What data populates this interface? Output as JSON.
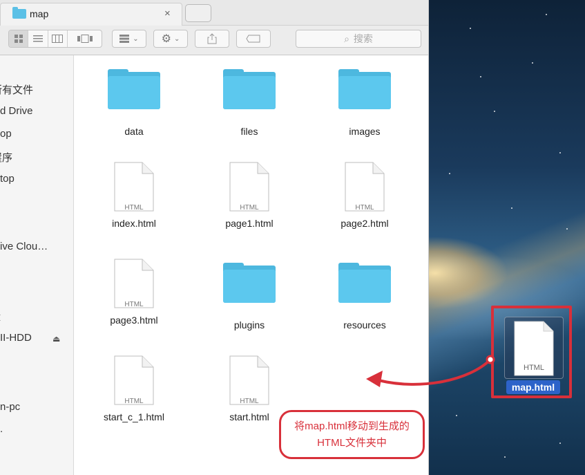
{
  "window": {
    "tab_title": "map",
    "tab_close": "×",
    "search_placeholder": "搜索"
  },
  "sidebar": {
    "items": [
      {
        "label": "所有文件",
        "partial": "斤有文件"
      },
      {
        "label": "d Drive"
      },
      {
        "label": "op"
      },
      {
        "label": "崖序"
      },
      {
        "label": "top"
      },
      {
        "label": "ive Clou…"
      },
      {
        "label": "盘",
        "partial": "ㄛ盘"
      },
      {
        "label": "II-HDD"
      },
      {
        "label": "n-pc"
      },
      {
        "label": "."
      }
    ],
    "eject_icon": "⏏"
  },
  "files": [
    {
      "name": "data",
      "kind": "folder"
    },
    {
      "name": "files",
      "kind": "folder"
    },
    {
      "name": "images",
      "kind": "folder"
    },
    {
      "name": "index.html",
      "kind": "html"
    },
    {
      "name": "page1.html",
      "kind": "html"
    },
    {
      "name": "page2.html",
      "kind": "html"
    },
    {
      "name": "page3.html",
      "kind": "html"
    },
    {
      "name": "plugins",
      "kind": "folder"
    },
    {
      "name": "resources",
      "kind": "folder"
    },
    {
      "name": "start_c_1.html",
      "kind": "html"
    },
    {
      "name": "start.html",
      "kind": "html"
    }
  ],
  "doc_badge": "HTML",
  "desktop_file": {
    "name": "map.html",
    "badge": "HTML"
  },
  "annotation": {
    "text": "将map.html移动到生成的HTML文件夹中",
    "color": "#d8303a"
  },
  "colors": {
    "folder": "#5cc8ee",
    "selection": "#2d63c9"
  }
}
